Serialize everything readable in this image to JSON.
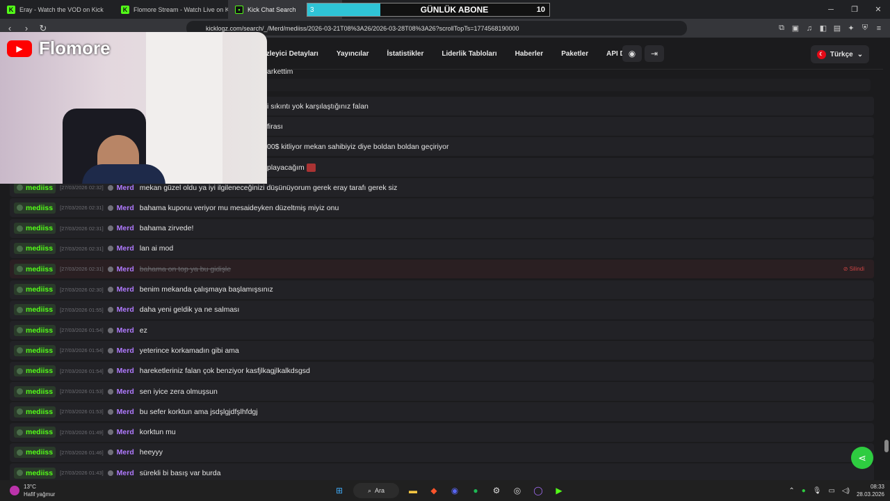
{
  "browser": {
    "tabs": [
      {
        "title": "Eray - Watch the VOD on Kick",
        "icon": "kick-icon"
      },
      {
        "title": "Flomore Stream - Watch Live on Kick",
        "icon": "kick-icon"
      },
      {
        "title": "Kick Chat Search",
        "icon": "kick-chat-icon"
      }
    ],
    "url": "kicklogz.com/search/_/Merd/mediiss/2026-03-21T08%3A26/2026-03-28T08%3A26?scrollTopTs=1774568190000"
  },
  "sub_widget": {
    "title": "GÜNLÜK ABONE",
    "current": "3",
    "goal": "10",
    "progress": 0.3
  },
  "overlay": {
    "channel_name": "Flomore"
  },
  "site_nav": {
    "links": [
      "İzleyici Detayları",
      "Yayıncılar",
      "İstatistikler",
      "Liderlik Tabloları",
      "Haberler",
      "Paketler",
      "API Docs"
    ],
    "language": "Türkçe"
  },
  "partial_messages": [
    "arkettim",
    "i sıkıntı yok karşılaştığınız falan",
    "firası",
    "00$ kitliyor mekan sahibiyiz diye boldan boldan geçiriyor",
    "playacağım"
  ],
  "messages": [
    {
      "user": "mediiss",
      "time": "[27/03/2026 02:32]",
      "target": "Merd",
      "text": "mekan güzel oldu ya iyi ilgileneceğinizi düşünüyorum gerek eray tarafı gerek siz"
    },
    {
      "user": "mediiss",
      "time": "[27/03/2026 02:31]",
      "target": "Merd",
      "text": "bahama kuponu veriyor mu mesaideyken düzeltmiş miyiz onu"
    },
    {
      "user": "mediiss",
      "time": "[27/03/2026 02:31]",
      "target": "Merd",
      "text": "bahama zirvede!"
    },
    {
      "user": "mediiss",
      "time": "[27/03/2026 02:31]",
      "target": "Merd",
      "text": "lan ai mod"
    },
    {
      "user": "mediiss",
      "time": "[27/03/2026 02:31]",
      "target": "Merd",
      "text": "bahama on top ya bu gidişle",
      "deleted": "Silindi"
    },
    {
      "user": "mediiss",
      "time": "[27/03/2026 02:30]",
      "target": "Merd",
      "text": "benim mekanda çalışmaya başlamışsınız"
    },
    {
      "user": "mediiss",
      "time": "[27/03/2026 01:55]",
      "target": "Merd",
      "text": "daha yeni geldik ya ne salması"
    },
    {
      "user": "mediiss",
      "time": "[27/03/2026 01:54]",
      "target": "Merd",
      "text": "ez"
    },
    {
      "user": "mediiss",
      "time": "[27/03/2026 01:54]",
      "target": "Merd",
      "text": "yeterince korkamadın gibi ama"
    },
    {
      "user": "mediiss",
      "time": "[27/03/2026 01:54]",
      "target": "Merd",
      "text": "hareketleriniz falan çok benziyor kasfjlkagjlkalkdsgsd"
    },
    {
      "user": "mediiss",
      "time": "[27/03/2026 01:53]",
      "target": "Merd",
      "text": "sen iyice zera olmuşsun"
    },
    {
      "user": "mediiss",
      "time": "[27/03/2026 01:53]",
      "target": "Merd",
      "text": "bu sefer korktun ama jsdşlgjdfşlhfdgj"
    },
    {
      "user": "mediiss",
      "time": "[27/03/2026 01:49]",
      "target": "Merd",
      "text": "korktun mu"
    },
    {
      "user": "mediiss",
      "time": "[27/03/2026 01:46]",
      "target": "Merd",
      "text": "heeyyy"
    },
    {
      "user": "mediiss",
      "time": "[27/03/2026 01:43]",
      "target": "Merd",
      "text": "sürekli bi basış var burda"
    }
  ],
  "taskbar": {
    "temperature": "13°C",
    "weather": "Hafif yağmur",
    "search_label": "Ara",
    "time": "08:33",
    "date": "28.03.2026"
  }
}
